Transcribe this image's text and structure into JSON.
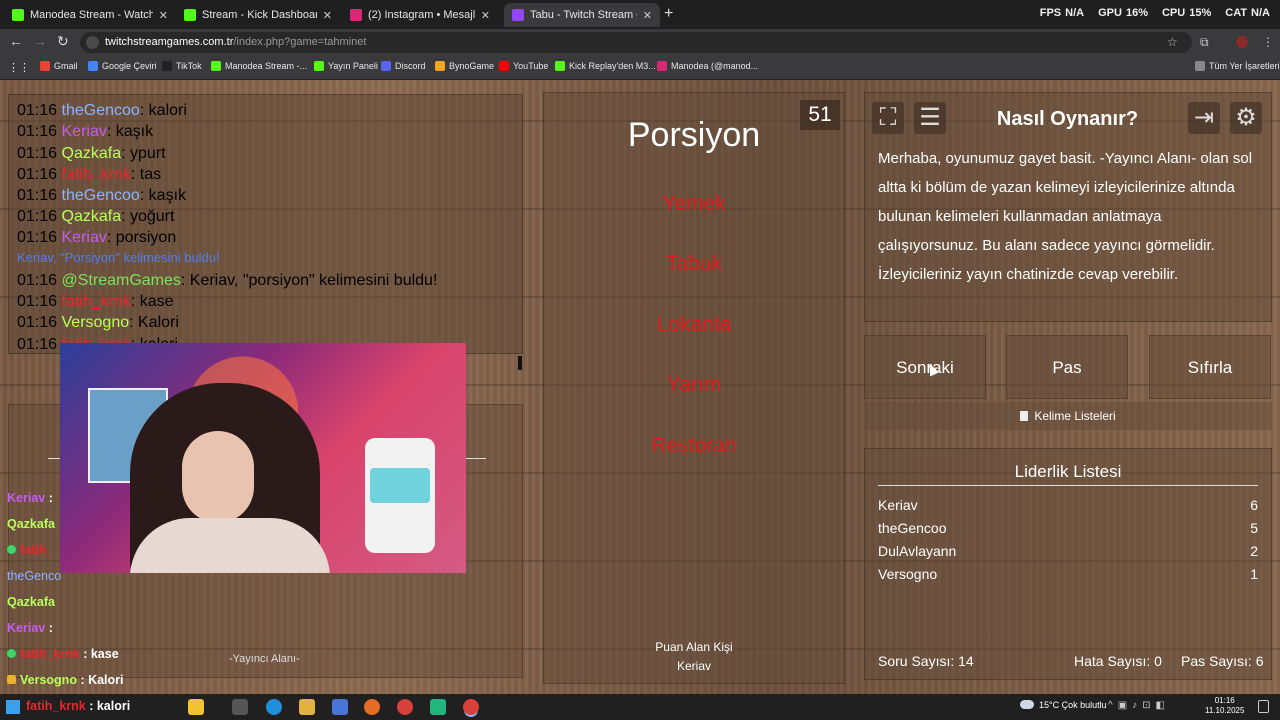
{
  "browser": {
    "tabs": [
      {
        "label": "Manodea Stream - Watch Live",
        "color": "#53fc18"
      },
      {
        "label": "Stream - Kick Dashboard",
        "color": "#53fc18"
      },
      {
        "label": "(2) Instagram • Mesajlar",
        "color": "#d62976"
      },
      {
        "label": "Tabu - Twitch Stream Game",
        "color": "#9146ff"
      }
    ],
    "stats": {
      "fps_label": "FPS",
      "fps": "N/A",
      "gpu_label": "GPU",
      "gpu": "16%",
      "cpu_label": "CPU",
      "cpu": "15%",
      "cat_label": "CAT",
      "cat": "N/A"
    },
    "url_host": "twitchstreamgames.com.tr",
    "url_path": "/index.php?game=tahminet",
    "bookmarks": [
      {
        "label": "Gmail",
        "color": "#ea4335"
      },
      {
        "label": "Google Çeviri",
        "color": "#4285f4"
      },
      {
        "label": "TikTok",
        "color": "#222222"
      },
      {
        "label": "Manodea Stream -...",
        "color": "#53fc18"
      },
      {
        "label": "Yayın Paneli",
        "color": "#53fc18"
      },
      {
        "label": "Discord",
        "color": "#5865f2"
      },
      {
        "label": "BynoGame",
        "color": "#f5a623"
      },
      {
        "label": "YouTube",
        "color": "#ff0000"
      },
      {
        "label": "Kick Replay'den M3...",
        "color": "#53fc18"
      },
      {
        "label": "Manodea (@manod...",
        "color": "#d62976"
      }
    ],
    "all_bookmarks": "Tüm Yer İşaretleri"
  },
  "chat": {
    "lines": [
      {
        "time": "01:16",
        "user": "theGencoo",
        "color": "#8ab4ff",
        "msg": ": kalori"
      },
      {
        "time": "01:16",
        "user": "Keriav",
        "color": "#c75cf0",
        "msg": ": kaşık"
      },
      {
        "time": "01:16",
        "user": "Qazkafa",
        "color": "#b7ff5a",
        "msg": ": ypurt"
      },
      {
        "time": "01:16",
        "user": "fatih_krnk",
        "color": "#e8262b",
        "msg": ": tas"
      },
      {
        "time": "01:16",
        "user": "theGencoo",
        "color": "#8ab4ff",
        "msg": ": kaşık"
      },
      {
        "time": "01:16",
        "user": "Qazkafa",
        "color": "#b7ff5a",
        "msg": ": yoğurt"
      },
      {
        "time": "01:16",
        "user": "Keriav",
        "color": "#c75cf0",
        "msg": ": porsiyon"
      },
      {
        "time": "",
        "user": "",
        "color": "#4f7ff0",
        "msg": ""
      },
      {
        "time": "01:16",
        "user": "@StreamGames",
        "color": "#7fe05a",
        "msg": ": Keriav, \"porsiyon\" kelimesini buldu!"
      },
      {
        "time": "01:16",
        "user": "fatih_krnk",
        "color": "#e8262b",
        "msg": ": kase"
      },
      {
        "time": "01:16",
        "user": "Versogno",
        "color": "#b7ff5a",
        "msg": ": Kalori"
      },
      {
        "time": "01:16",
        "user": "fatih_krnk",
        "color": "#e8262b",
        "msg": ": kalori"
      }
    ],
    "system_notice": "Keriav, \"Porsiyon\" kelimesini buldu!"
  },
  "overlay": {
    "names": [
      {
        "name": "Keriav",
        "suffix": " :",
        "color": "#c75cf0"
      },
      {
        "name": "Qazkafa",
        "suffix": "",
        "color": "#b7ff5a"
      },
      {
        "name": "fatih_",
        "suffix": "",
        "color": "#e8262b"
      },
      {
        "name": "theGenco",
        "suffix": "",
        "color": "#8ab4ff"
      },
      {
        "name": "Qazkafa",
        "suffix": "",
        "color": "#b7ff5a"
      },
      {
        "name": "Keriav",
        "suffix": " :",
        "color": "#c75cf0"
      },
      {
        "name": "fatih_krnk",
        "suffix": " : kase",
        "color": "#e8262b"
      },
      {
        "name": "Versogno",
        "suffix": " : Kalori",
        "color": "#b7ff5a"
      }
    ],
    "label": "-Yayıncı Alanı-"
  },
  "game": {
    "word": "Porsiyon",
    "counter": "51",
    "forbidden": [
      "Yemek",
      "Tabak",
      "Lokanta",
      "Yarım",
      "Restoran"
    ],
    "scorer_label": "Puan Alan Kişi",
    "scorer_name": "Keriav"
  },
  "howto": {
    "title": "Nasıl Oynanır?",
    "text": "Merhaba, oyunumuz gayet basit. -Yayıncı Alanı- olan sol altta ki bölüm de yazan kelimeyi izleyicilerinize altında bulunan kelimeleri kullanmadan anlatmaya çalışıyorsunuz. Bu alanı sadece yayıncı görmelidir. İzleyicileriniz yayın chatinizde cevap verebilir."
  },
  "buttons": {
    "next": "Sonraki",
    "pass": "Pas",
    "reset": "Sıfırla",
    "word_lists": "Kelime Listeleri"
  },
  "leaderboard": {
    "title": "Liderlik Listesi",
    "rows": [
      {
        "name": "Keriav",
        "score": "6"
      },
      {
        "name": "theGencoo",
        "score": "5"
      },
      {
        "name": "DulAvlayann",
        "score": "2"
      },
      {
        "name": "Versogno",
        "score": "1"
      }
    ]
  },
  "stats": {
    "questions": "Soru Sayısı: 14",
    "errors": "Hata Sayısı: 0",
    "passes": "Pas Sayısı: 6"
  },
  "taskbar": {
    "chat_user": "fatih_krnk",
    "chat_msg": " : kalori",
    "weather": "15°C  Çok bulutlu",
    "time": "01:16",
    "date": "11.10.2025"
  }
}
